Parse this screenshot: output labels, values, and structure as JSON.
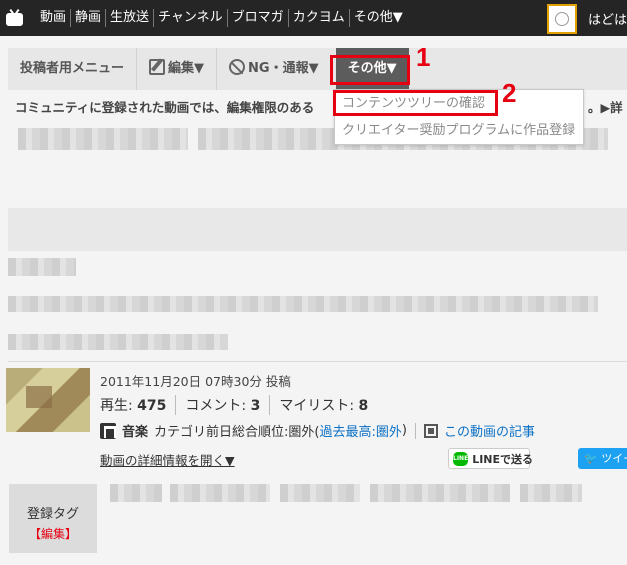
{
  "topnav": {
    "items": [
      "動画",
      "静画",
      "生放送",
      "チャンネル",
      "ブロマガ",
      "カクヨム",
      "その他▼"
    ],
    "user_name": "はどはん"
  },
  "menubar": {
    "poster_menu": "投稿者用メニュー",
    "edit": "編集▼",
    "ng_report": "NG・通報▼",
    "other": "その他▼"
  },
  "annotations": {
    "step1": "1",
    "step2": "2",
    "highlight_color": "#e60012"
  },
  "dropdown": {
    "items": [
      "コンテンツツリーの確認",
      "クリエイター奨励プログラムに作品登録"
    ]
  },
  "notice": {
    "text": "コミュニティに登録された動画では、編集権限のある",
    "right": "。▶詳"
  },
  "video": {
    "posted": "2011年11月20日 07時30分 投稿",
    "views_label": "再生: ",
    "views": "475",
    "comments_label": "コメント: ",
    "comments": "3",
    "mylist_label": "マイリスト: ",
    "mylist": "8",
    "category": "音楽",
    "rank_text": "カテゴリ前日総合順位:圏外(",
    "rank_link": "過去最高:圏外",
    "rank_close": ")",
    "article_link": "この動画の記事",
    "detail_link": "動画の詳細情報を開く▼",
    "line_button": "LINEで送る",
    "tweet_button": "ツイー"
  },
  "tags": {
    "label": "登録タグ",
    "edit": "【編集】"
  }
}
